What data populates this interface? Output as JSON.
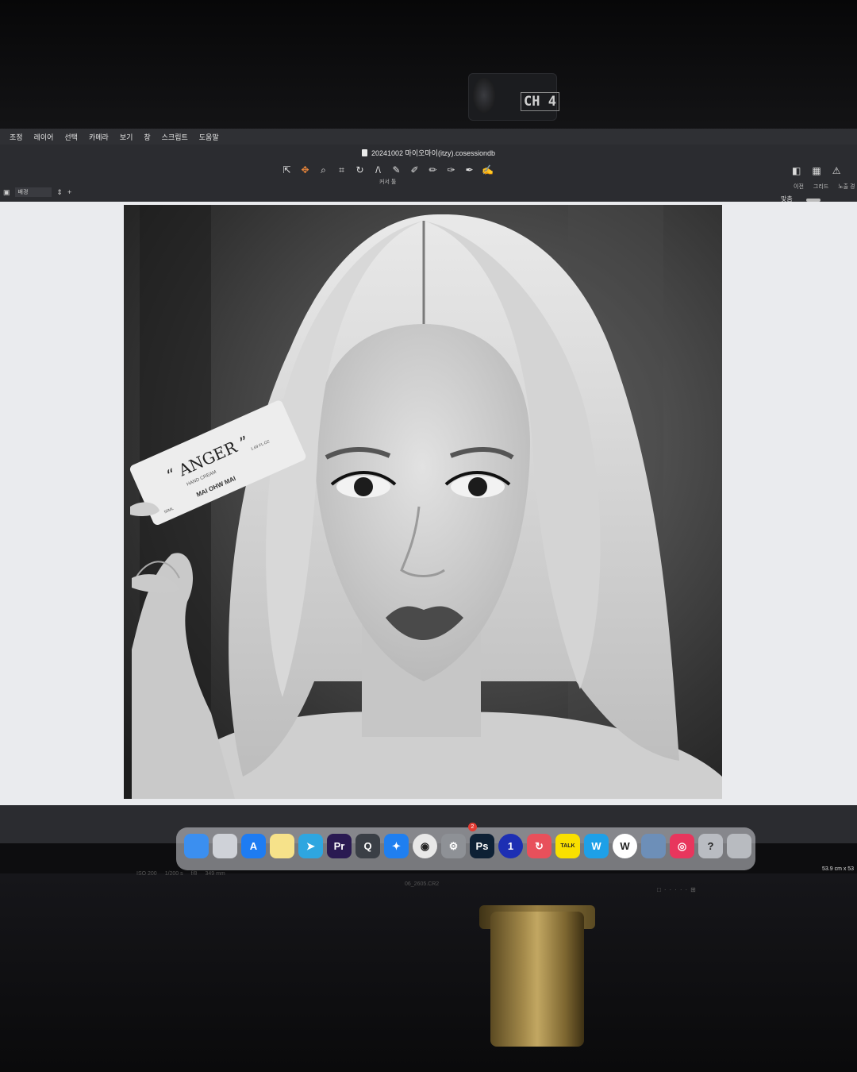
{
  "device": {
    "label": "CH 4"
  },
  "app": {
    "menu": [
      "조정",
      "레이어",
      "선택",
      "카메라",
      "보기",
      "창",
      "스크립트",
      "도움말"
    ],
    "document_title": "20241002 마이오마이(itzy).cosessiondb",
    "toolbar_caption": "커서 툴",
    "right_captions": [
      "이전",
      "그리드",
      "노출 경"
    ],
    "layer_name": "배경",
    "fit_label": "맞춤"
  },
  "photo": {
    "product_brand_quote": "ANGER",
    "product_type": "HAND CREAM",
    "product_maker": "MAI OHW MAI",
    "product_volume": "1.69 FL.OZ",
    "product_ml": "50ML"
  },
  "capture_info": {
    "iso": "ISO 200",
    "shutter": "1/200 s",
    "aperture": "f/8",
    "focal": "349 mm",
    "file_name": "06_2605.CR2"
  },
  "dock": {
    "badge": "2",
    "icons": [
      {
        "name": "finder",
        "label": "",
        "color": "#3b8ff0"
      },
      {
        "name": "launchpad",
        "label": "",
        "color": "#cfd2d8"
      },
      {
        "name": "app-store",
        "label": "A",
        "color": "#1e7cf2"
      },
      {
        "name": "notes",
        "label": "",
        "color": "#f6e28a"
      },
      {
        "name": "telegram",
        "label": "➤",
        "color": "#2ea6e0"
      },
      {
        "name": "premiere-pro",
        "label": "Pr",
        "color": "#2a1a52"
      },
      {
        "name": "quicktime",
        "label": "Q",
        "color": "#3a3f46"
      },
      {
        "name": "safari",
        "label": "✦",
        "color": "#1f7ff0"
      },
      {
        "name": "chrome",
        "label": "◉",
        "color": "#e8e8e8"
      },
      {
        "name": "system-settings",
        "label": "⚙",
        "color": "#8e9196"
      },
      {
        "name": "photoshop",
        "label": "Ps",
        "color": "#0e2135"
      },
      {
        "name": "onestart",
        "label": "1",
        "color": "#1d2fb3"
      },
      {
        "name": "sync",
        "label": "↻",
        "color": "#e8505b"
      },
      {
        "name": "kakaotalk",
        "label": "TALK",
        "color": "#f9e000"
      },
      {
        "name": "word-app",
        "label": "W",
        "color": "#1ea0e8"
      },
      {
        "name": "whale",
        "label": "W",
        "color": "#ffffff"
      },
      {
        "name": "preview",
        "label": "",
        "color": "#6d8fb8"
      },
      {
        "name": "creative-cloud",
        "label": "◎",
        "color": "#e8365d"
      },
      {
        "name": "help",
        "label": "?",
        "color": "#b9bcc2"
      },
      {
        "name": "trash",
        "label": "",
        "color": "#b8bbc0"
      }
    ]
  },
  "size_readout": "53.9 cm x 53"
}
